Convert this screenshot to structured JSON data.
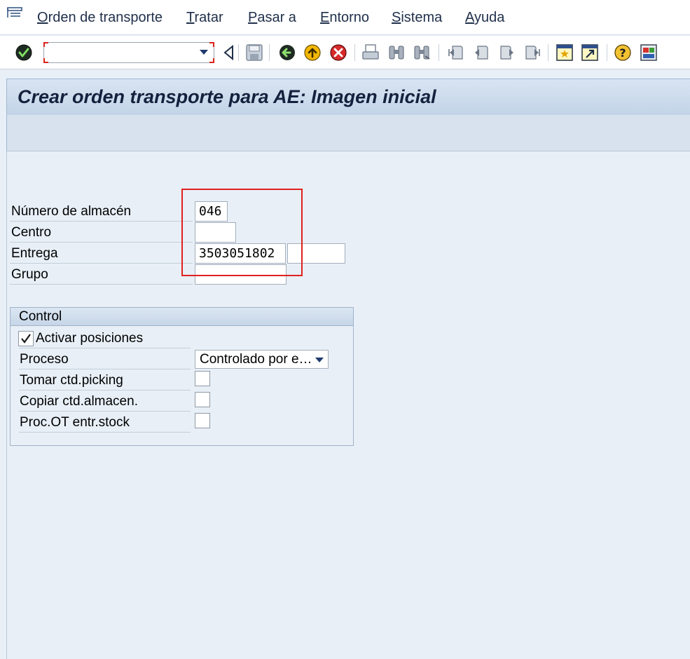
{
  "menu": {
    "items": [
      {
        "label": "Orden de transporte",
        "mnemonic": "O",
        "rest": "rden de transporte"
      },
      {
        "label": "Tratar",
        "mnemonic": "T",
        "rest": "ratar"
      },
      {
        "label": "Pasar a",
        "mnemonic": "P",
        "rest": "asar a"
      },
      {
        "label": "Entorno",
        "mnemonic": "E",
        "rest": "ntorno"
      },
      {
        "label": "Sistema",
        "mnemonic": "S",
        "rest": "istema"
      },
      {
        "label": "Ayuda",
        "mnemonic": "A",
        "rest": "yuda"
      }
    ]
  },
  "toolbar": {
    "command_field_value": "",
    "icons": [
      "enter-check-icon",
      "collapse-triangle-icon",
      "save-icon",
      "back-icon",
      "exit-icon",
      "cancel-icon",
      "print-icon",
      "find-icon",
      "find-next-icon",
      "first-page-icon",
      "previous-page-icon",
      "next-page-icon",
      "last-page-icon",
      "create-session-icon",
      "shortcut-icon",
      "help-icon",
      "customize-layout-icon"
    ]
  },
  "title": "Crear orden transporte para AE: Imagen inicial",
  "form": {
    "warehouse_label": "Número de almacén",
    "warehouse_value": "046",
    "plant_label": "Centro",
    "plant_value": "",
    "delivery_label": "Entrega",
    "delivery_value": "3503051802",
    "delivery_extra_value": "",
    "group_label": "Grupo",
    "group_value": ""
  },
  "control": {
    "title": "Control",
    "activate_items_label": "Activar posiciones",
    "activate_items_checked": true,
    "process_label": "Proceso",
    "process_value": "Controlado por e…",
    "take_picking_qty_label": "Tomar ctd.picking",
    "take_picking_qty_checked": false,
    "copy_wh_qty_label": "Copiar ctd.almacen.",
    "copy_wh_qty_checked": false,
    "proc_to_stock_label": "Proc.OT entr.stock",
    "proc_to_stock_checked": false
  },
  "colors": {
    "highlight": "#e02020",
    "title_text": "#14213d",
    "workarea_bg": "#e8eff7"
  }
}
